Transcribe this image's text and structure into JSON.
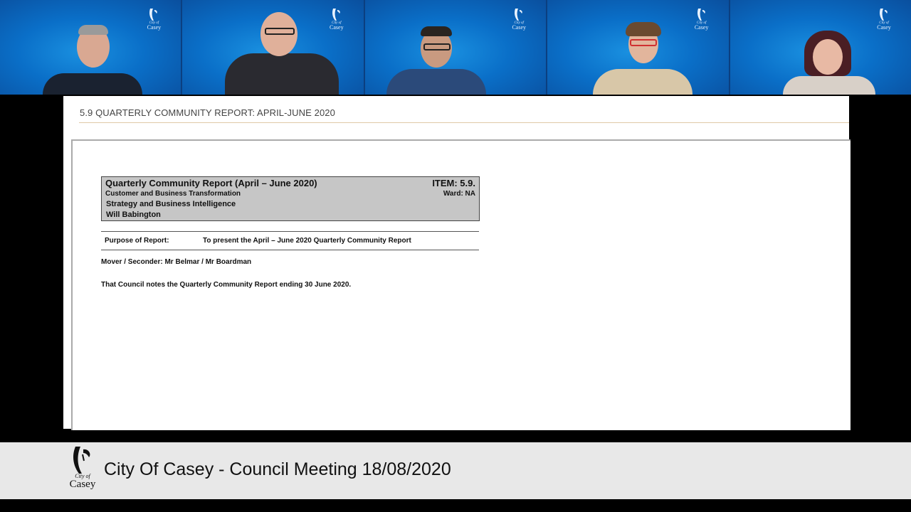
{
  "participants": [
    {
      "logo_small": "City of",
      "logo_name": "Casey"
    },
    {
      "logo_small": "City of",
      "logo_name": "Casey"
    },
    {
      "logo_small": "City of",
      "logo_name": "Casey"
    },
    {
      "logo_small": "City of",
      "logo_name": "Casey"
    },
    {
      "logo_small": "City of",
      "logo_name": "Casey"
    }
  ],
  "slide": {
    "title": "5.9 QUARTERLY COMMUNITY REPORT: APRIL-JUNE 2020",
    "item": {
      "title": "Quarterly Community Report (April – June 2020)",
      "number": "ITEM: 5.9.",
      "department": "Customer and Business Transformation",
      "ward": "Ward: NA",
      "unit": "Strategy and Business Intelligence",
      "officer": "Will Babington"
    },
    "purpose_label": "Purpose of Report:",
    "purpose_value": "To present the April – June 2020 Quarterly Community Report",
    "mover": "Mover / Seconder: Mr Belmar / Mr Boardman",
    "motion": "That Council notes the Quarterly Community Report ending 30 June 2020."
  },
  "banner": {
    "logo_small": "City of",
    "logo_name": "Casey",
    "text": "City Of Casey - Council Meeting 18/08/2020"
  },
  "colors": {
    "tile_blue": "#0a6fc8",
    "slide_rule": "#e0c9a7",
    "item_box": "#c6c6c6",
    "banner_bg": "#e8e8e8"
  }
}
